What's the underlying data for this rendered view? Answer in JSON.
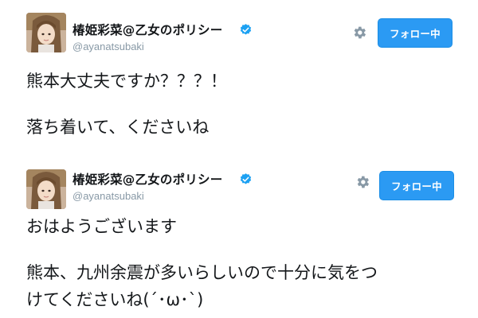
{
  "tweets": [
    {
      "display_name": "椿姫彩菜@乙女のポリシー",
      "handle": "@ayanatsubaki",
      "follow_label": "フォロー中",
      "text_lines": [
        "熊本大丈夫ですか？？？！",
        "落ち着いて、くださいね"
      ]
    },
    {
      "display_name": "椿姫彩菜@乙女のポリシー",
      "handle": "@ayanatsubaki",
      "follow_label": "フォロー中",
      "text_lines": [
        "おはようございます",
        "熊本、九州余震が多いらしいので十分に気をつ",
        "けてくださいね(´･ω･`)"
      ]
    }
  ],
  "icons": {
    "verified": "verified-badge-icon",
    "settings": "gear-icon",
    "avatar": "profile-photo"
  },
  "colors": {
    "follow_button": "#2b9af3",
    "verified_badge": "#1da1f2",
    "handle_text": "#8899a6",
    "gear": "#8899a6"
  }
}
